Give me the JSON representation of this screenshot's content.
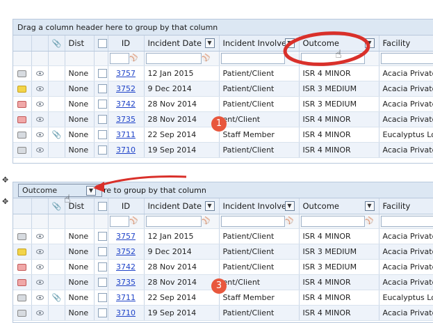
{
  "group_hint": "Drag a column header here to group by that column",
  "group_hint_partial": "re to group by that column",
  "drag_ghost_label": "Outcome",
  "columns": [
    "",
    "",
    "",
    "Dist",
    "",
    "ID",
    "Incident Date",
    "Incident Involved",
    "Outcome",
    "Facility"
  ],
  "rows": [
    {
      "dist": "None",
      "id": "3757",
      "date": "12 Jan 2015",
      "involved": "Patient/Client",
      "outcome": "ISR 4 MINOR",
      "facility": "Acacia Private",
      "env": "gray",
      "clip": false
    },
    {
      "dist": "None",
      "id": "3752",
      "date": "9 Dec 2014",
      "involved": "Patient/Client",
      "outcome": "ISR 3 MEDIUM",
      "facility": "Acacia Private",
      "env": "yellow",
      "clip": false
    },
    {
      "dist": "None",
      "id": "3742",
      "date": "28 Nov 2014",
      "involved": "Patient/Client",
      "outcome": "ISR 3 MEDIUM",
      "facility": "Acacia Private",
      "env": "red",
      "clip": false
    },
    {
      "dist": "None",
      "id": "3735",
      "date": "28 Nov 2014",
      "involved": "ent/Client",
      "outcome": "ISR 4 MINOR",
      "facility": "Acacia Private",
      "env": "red",
      "clip": false
    },
    {
      "dist": "None",
      "id": "3711",
      "date": "22 Sep 2014",
      "involved": "Staff Member",
      "outcome": "ISR 4 MINOR",
      "facility": "Eucalyptus Lodge",
      "env": "gray",
      "clip": true
    },
    {
      "dist": "None",
      "id": "3710",
      "date": "19 Sep 2014",
      "involved": "Patient/Client",
      "outcome": "ISR 4 MINOR",
      "facility": "Acacia Private",
      "env": "gray",
      "clip": false
    }
  ],
  "badges": [
    "1",
    "3"
  ],
  "colors": {
    "badge": "#e8573d",
    "annotation": "#d9302a",
    "link": "#1f43c8"
  }
}
